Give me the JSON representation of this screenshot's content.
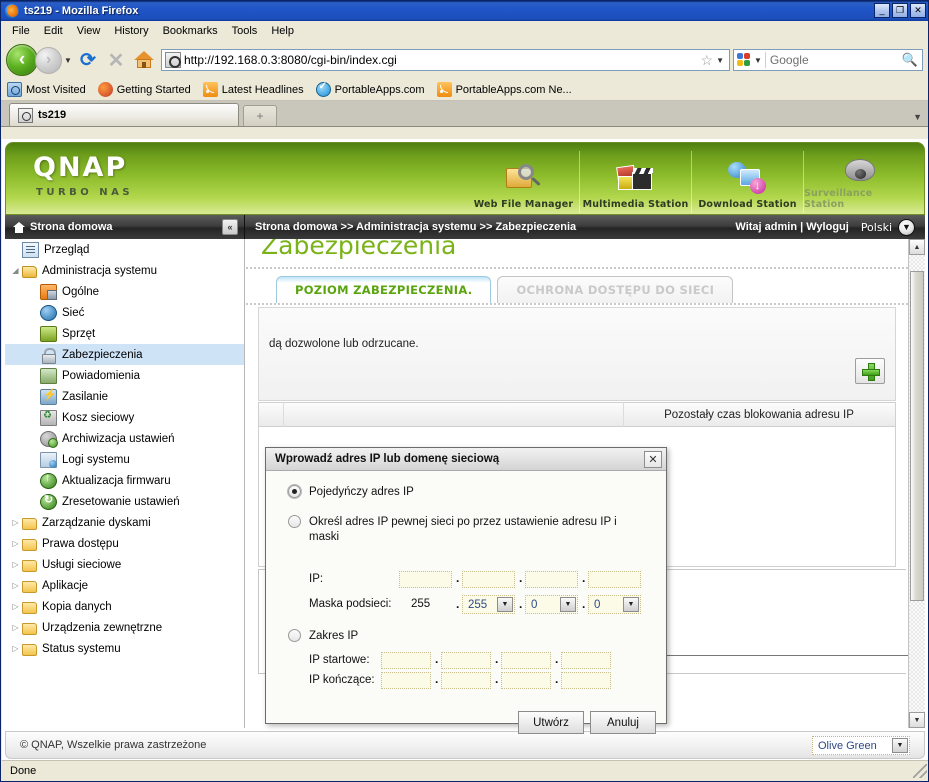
{
  "browser": {
    "window_title": "ts219 - Mozilla Firefox",
    "window_buttons": {
      "minimize": "_",
      "maximize": "❐",
      "close": "✕"
    },
    "menu": [
      "File",
      "Edit",
      "View",
      "History",
      "Bookmarks",
      "Tools",
      "Help"
    ],
    "url": "http://192.168.0.3:8080/cgi-bin/index.cgi",
    "search_placeholder": "Google",
    "bookmarks": [
      "Most Visited",
      "Getting Started",
      "Latest Headlines",
      "PortableApps.com",
      "PortableApps.com Ne..."
    ],
    "tab_label": "ts219",
    "newtab_label": "+",
    "status_text": "Done"
  },
  "banner": {
    "logo": "QNAP",
    "tagline": "TURBO NAS",
    "apps": [
      {
        "label": "Web File Manager",
        "dim": false
      },
      {
        "label": "Multimedia Station",
        "dim": false
      },
      {
        "label": "Download Station",
        "dim": false
      },
      {
        "label": "Surveillance Station",
        "dim": true
      }
    ]
  },
  "navstrip": {
    "home_label": "Strona domowa",
    "collapse_label": "«",
    "breadcrumb": "Strona domowa >> Administracja systemu >> Zabezpieczenia",
    "welcome": "Witaj admin | Wyloguj",
    "language": "Polski",
    "language_arrow": "▼"
  },
  "sidebar": {
    "items": [
      {
        "label": "Przegląd",
        "level": 1,
        "icon": "list-icon",
        "arrow": "",
        "selected": false,
        "icon_class": "ic-list"
      },
      {
        "label": "Administracja systemu",
        "level": 1,
        "icon": "folder-open-icon",
        "arrow": "◢",
        "selected": false,
        "icon_class": "fold-open"
      },
      {
        "label": "Ogólne",
        "level": 2,
        "icon": "general-icon",
        "arrow": "",
        "selected": false,
        "icon_class": "ic-gen"
      },
      {
        "label": "Sieć",
        "level": 2,
        "icon": "network-icon",
        "arrow": "",
        "selected": false,
        "icon_class": "ic-net"
      },
      {
        "label": "Sprzęt",
        "level": 2,
        "icon": "hardware-icon",
        "arrow": "",
        "selected": false,
        "icon_class": "ic-hw"
      },
      {
        "label": "Zabezpieczenia",
        "level": 2,
        "icon": "lock-icon",
        "arrow": "",
        "selected": true,
        "icon_class": "ic-lock"
      },
      {
        "label": "Powiadomienia",
        "level": 2,
        "icon": "notification-icon",
        "arrow": "",
        "selected": false,
        "icon_class": "ic-notify"
      },
      {
        "label": "Zasilanie",
        "level": 2,
        "icon": "power-icon",
        "arrow": "",
        "selected": false,
        "icon_class": "ic-power"
      },
      {
        "label": "Kosz sieciowy",
        "level": 2,
        "icon": "recycle-bin-icon",
        "arrow": "",
        "selected": false,
        "icon_class": "ic-trash"
      },
      {
        "label": "Archiwizacja ustawień",
        "level": 2,
        "icon": "backup-icon",
        "arrow": "",
        "selected": false,
        "icon_class": "ic-backup"
      },
      {
        "label": "Logi systemu",
        "level": 2,
        "icon": "log-icon",
        "arrow": "",
        "selected": false,
        "icon_class": "ic-log"
      },
      {
        "label": "Aktualizacja firmwaru",
        "level": 2,
        "icon": "firmware-update-icon",
        "arrow": "",
        "selected": false,
        "icon_class": "ic-fw"
      },
      {
        "label": "Zresetowanie ustawień",
        "level": 2,
        "icon": "reset-icon",
        "arrow": "",
        "selected": false,
        "icon_class": "ic-reset"
      },
      {
        "label": "Zarządzanie dyskami",
        "level": 1,
        "icon": "folder-icon",
        "arrow": "▷",
        "selected": false,
        "icon_class": "fold-ic"
      },
      {
        "label": "Prawa dostępu",
        "level": 1,
        "icon": "folder-icon",
        "arrow": "▷",
        "selected": false,
        "icon_class": "fold-ic"
      },
      {
        "label": "Usługi sieciowe",
        "level": 1,
        "icon": "folder-icon",
        "arrow": "▷",
        "selected": false,
        "icon_class": "fold-ic"
      },
      {
        "label": "Aplikacje",
        "level": 1,
        "icon": "folder-icon",
        "arrow": "▷",
        "selected": false,
        "icon_class": "fold-ic"
      },
      {
        "label": "Kopia danych",
        "level": 1,
        "icon": "folder-icon",
        "arrow": "▷",
        "selected": false,
        "icon_class": "fold-ic"
      },
      {
        "label": "Urządzenia zewnętrzne",
        "level": 1,
        "icon": "folder-icon",
        "arrow": "▷",
        "selected": false,
        "icon_class": "fold-ic"
      },
      {
        "label": "Status systemu",
        "level": 1,
        "icon": "folder-icon",
        "arrow": "▷",
        "selected": false,
        "icon_class": "fold-ic"
      }
    ]
  },
  "content": {
    "page_title": "Zabezpieczenia",
    "tabs": [
      {
        "label": "POZIOM ZABEZPIECZENIA.",
        "active": true
      },
      {
        "label": "OCHRONA DOSTĘPU DO SIECI",
        "active": false
      }
    ],
    "hint_text": "dą dozwolone lub odrzucane.",
    "add_button": "+",
    "table_header": "Pozostały czas blokowania adresu IP"
  },
  "dialog": {
    "title": "Wprowadź adres IP lub domenę sieciową",
    "close": "✕",
    "option_single": "Pojedyńczy adres IP",
    "option_network": "Określ adres IP pewnej sieci po przez ustawienie adresu IP i maski",
    "label_ip": "IP:",
    "label_mask": "Maska podsieci:",
    "mask_octet1": "255",
    "mask_octet2": "255",
    "mask_octet3": "0",
    "mask_octet4": "0",
    "option_range": "Zakres IP",
    "label_start_ip": "IP startowe:",
    "label_end_ip": "IP kończące:",
    "btn_create": "Utwórz",
    "btn_cancel": "Anuluj",
    "dot": ".",
    "dropdown_arrow": "▼",
    "ip_value": ""
  },
  "page_footer": {
    "copyright": "© QNAP, Wszelkie prawa zastrzeżone",
    "theme": "Olive Green",
    "theme_arrow": "▼"
  }
}
